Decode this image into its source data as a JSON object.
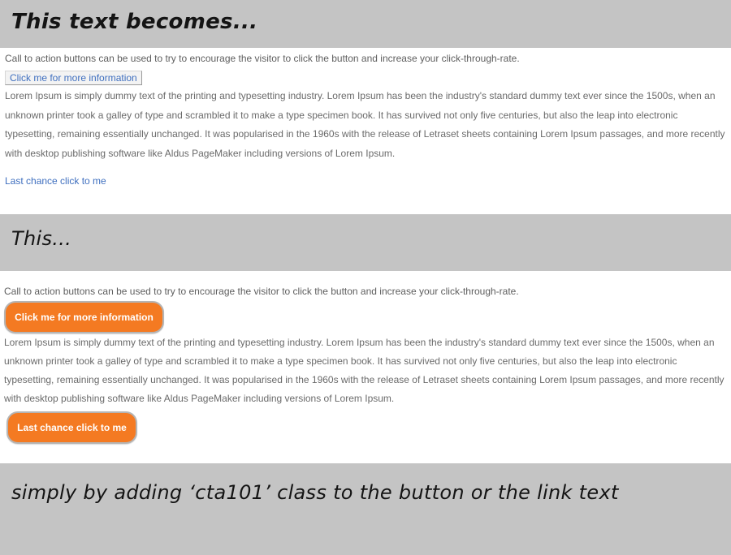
{
  "headings": {
    "before": "This text becomes...",
    "after": "This...",
    "caption": "simply by adding ‘cta101’ class to the button or the link text"
  },
  "content": {
    "intro": "Call to action buttons can be used to try to encourage the visitor to click the button and increase your click-through-rate.",
    "button_label": "Click me for more information",
    "body": "Lorem Ipsum is simply dummy text of the printing and typesetting industry. Lorem Ipsum has been the industry's standard dummy text ever since the 1500s, when an unknown printer took a galley of type and scrambled it to make a type specimen book. It has survived not only five centuries, but also the leap into electronic typesetting, remaining essentially unchanged. It was popularised in the 1960s with the release of Letraset sheets containing Lorem Ipsum passages, and more recently with desktop publishing software like Aldus PageMaker including versions of Lorem Ipsum.",
    "link_label": "Last chance click to me"
  },
  "colors": {
    "band_background": "#c4c4c4",
    "link_blue": "#3f6fbf",
    "cta_orange": "#f47a22",
    "body_text": "#6a6a6a"
  }
}
